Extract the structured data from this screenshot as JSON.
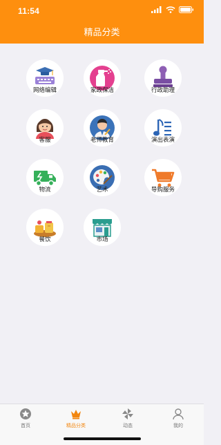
{
  "status_bar": {
    "time": "11:54"
  },
  "header": {
    "title": "精品分类"
  },
  "categories": [
    {
      "label": "网络编辑",
      "icon": "graduation-keyboard-icon"
    },
    {
      "label": "家政保洁",
      "icon": "spray-bottle-icon"
    },
    {
      "label": "行政助理",
      "icon": "stamp-icon"
    },
    {
      "label": "客服",
      "icon": "service-woman-icon"
    },
    {
      "label": "老师教育",
      "icon": "teacher-icon"
    },
    {
      "label": "演出表演",
      "icon": "music-note-icon"
    },
    {
      "label": "物流",
      "icon": "delivery-truck-icon"
    },
    {
      "label": "艺术",
      "icon": "palette-icon"
    },
    {
      "label": "导购服务",
      "icon": "shopping-cart-icon"
    },
    {
      "label": "餐饮",
      "icon": "food-icon"
    },
    {
      "label": "市场",
      "icon": "storefront-icon"
    }
  ],
  "tabbar": {
    "tabs": [
      {
        "label": "首页",
        "icon": "star-icon",
        "active": false
      },
      {
        "label": "精品分类",
        "icon": "crown-icon",
        "active": true
      },
      {
        "label": "动态",
        "icon": "pinwheel-icon",
        "active": false
      },
      {
        "label": "我的",
        "icon": "person-icon",
        "active": false
      }
    ]
  },
  "colors": {
    "accent": "#fe8f0e",
    "background": "#f1f0f5"
  }
}
